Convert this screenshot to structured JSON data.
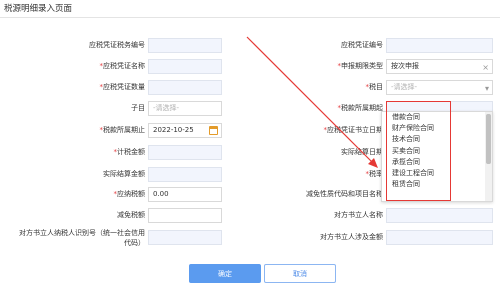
{
  "page": {
    "title": "税源明细录入页面"
  },
  "left_fields": [
    {
      "label": "应税凭证税务编号",
      "required": false,
      "value": "",
      "placeholder": ""
    },
    {
      "label": "应税凭证名称",
      "required": true,
      "value": "",
      "placeholder": ""
    },
    {
      "label": "应税凭证数量",
      "required": true,
      "value": "",
      "placeholder": ""
    },
    {
      "label": "子目",
      "required": false,
      "value": "",
      "placeholder": "-请选择-"
    },
    {
      "label": "税款所属期止",
      "required": true,
      "value": "2022-10-25",
      "placeholder": ""
    },
    {
      "label": "计税金额",
      "required": true,
      "value": "",
      "placeholder": ""
    },
    {
      "label": "实际结算金额",
      "required": false,
      "value": "",
      "placeholder": ""
    },
    {
      "label": "应纳税额",
      "required": true,
      "value": "0.00",
      "placeholder": ""
    },
    {
      "label": "减免税额",
      "required": false,
      "value": "",
      "placeholder": ""
    },
    {
      "label": "对方书立人纳税人识别号（统一社会信用代码）",
      "required": false,
      "value": "",
      "placeholder": ""
    }
  ],
  "right_fields": [
    {
      "label": "应税凭证编号",
      "required": false,
      "value": ""
    },
    {
      "label": "申报期限类型",
      "required": true,
      "value": "按次申报"
    },
    {
      "label": "税目",
      "required": true,
      "value": "",
      "placeholder": "-请选择-"
    },
    {
      "label": "税款所属期起",
      "required": true,
      "value": ""
    },
    {
      "label": "应税凭证书立日期",
      "required": true,
      "value": ""
    },
    {
      "label": "实际结算日期",
      "required": false,
      "value": ""
    },
    {
      "label": "税率",
      "required": true,
      "value": ""
    },
    {
      "label": "减免性质代码和项目名称",
      "required": false,
      "value": ""
    },
    {
      "label": "对方书立人名称",
      "required": false,
      "value": ""
    },
    {
      "label": "对方书立人涉及金额",
      "required": false,
      "value": ""
    }
  ],
  "dropdown": {
    "options": [
      "借款合同",
      "财产保险合同",
      "技术合同",
      "买卖合同",
      "承揽合同",
      "建设工程合同",
      "租赁合同"
    ]
  },
  "icons": {
    "clear": "×",
    "chevron": "▾",
    "calendar": "calendar-icon"
  },
  "buttons": {
    "confirm": "确定",
    "cancel": "取消"
  },
  "colors": {
    "required": "#e4393c",
    "primary": "#5b9bef",
    "annotation": "#e53935"
  }
}
